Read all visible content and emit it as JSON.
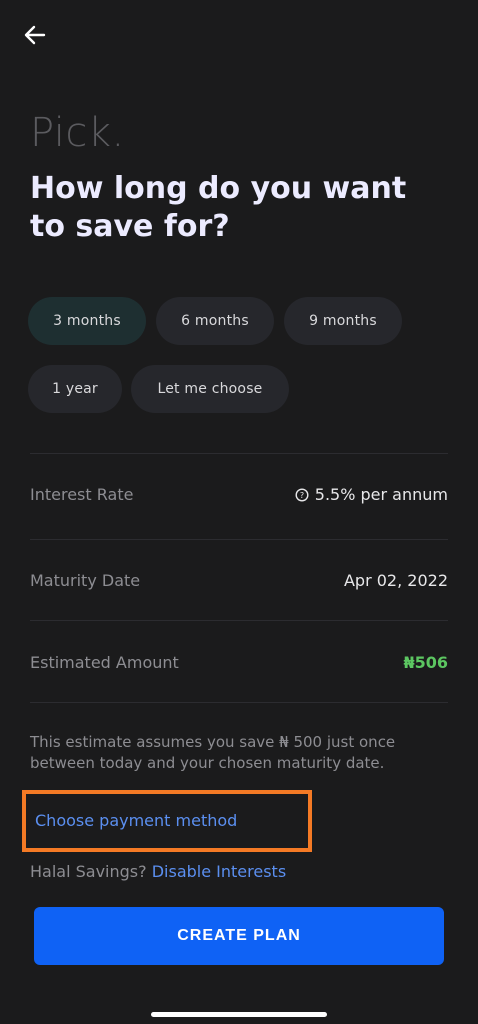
{
  "header": {
    "back_icon": "arrow-left-icon"
  },
  "title": {
    "pick": "Pick.",
    "question": "How long do you want to save for?"
  },
  "durations": [
    {
      "label": "3 months",
      "selected": true
    },
    {
      "label": "6 months",
      "selected": false
    },
    {
      "label": "9 months",
      "selected": false
    },
    {
      "label": "1 year",
      "selected": false
    },
    {
      "label": "Let me choose",
      "selected": false
    }
  ],
  "details": {
    "interest_rate": {
      "label": "Interest Rate",
      "value": "5.5% per annum",
      "icon": "info-icon"
    },
    "maturity_date": {
      "label": "Maturity Date",
      "value": "Apr 02, 2022"
    },
    "estimated_amount": {
      "label": "Estimated Amount",
      "value": "₦506"
    }
  },
  "note": "This estimate assumes you save ₦ 500 just once between today and your chosen maturity date.",
  "payment": {
    "link": "Choose payment method"
  },
  "halal": {
    "prompt": "Halal Savings?",
    "link": "Disable Interests"
  },
  "cta": {
    "label": "CREATE PLAN"
  },
  "colors": {
    "background": "#1b1b1c",
    "accent_blue": "#0f62f5",
    "link_blue": "#5b8ff0",
    "amount_green": "#5cc661",
    "highlight_orange": "#f47a25"
  }
}
